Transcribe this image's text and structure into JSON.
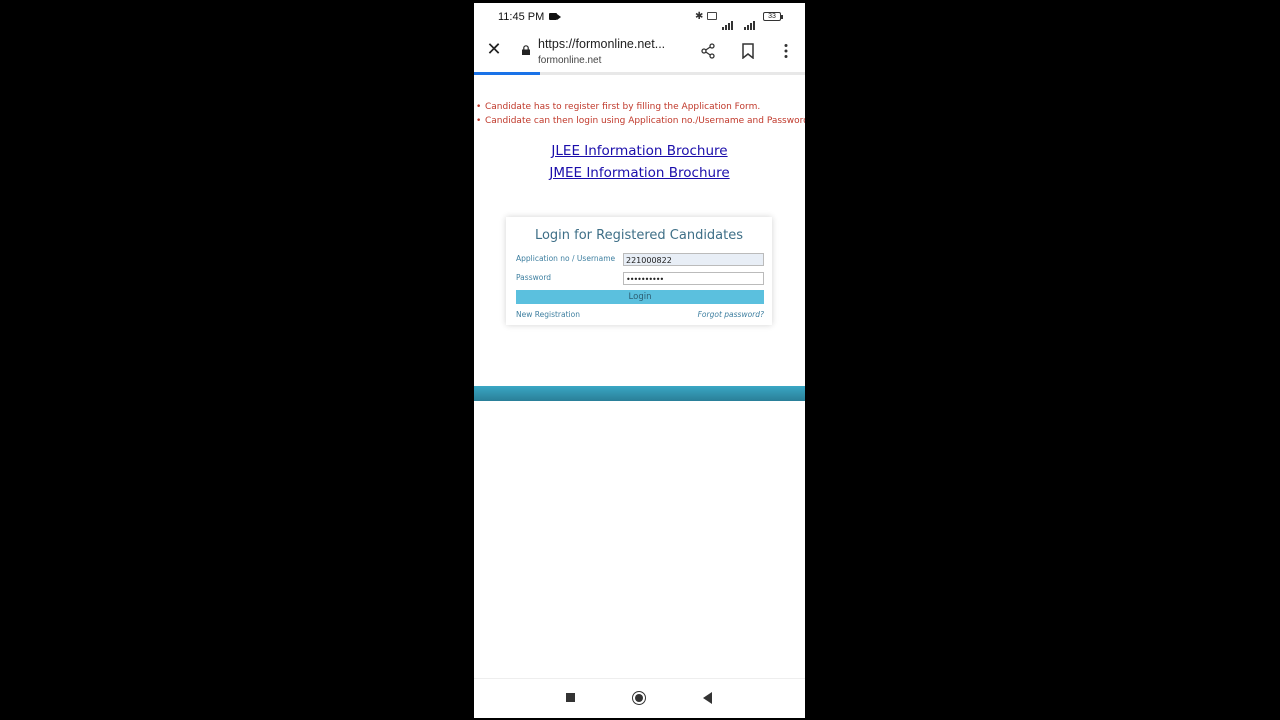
{
  "status_bar": {
    "time": "11:45 PM",
    "battery": "33",
    "icons": [
      "video-camera-icon",
      "bluetooth-icon",
      "nfc-icon",
      "signal-icon",
      "signal-icon",
      "battery-icon"
    ]
  },
  "browser": {
    "url": "https://formonline.net...",
    "domain": "formonline.net",
    "page_load_progress": 0.2,
    "icons": [
      "close-icon",
      "lock-icon",
      "share-icon",
      "bookmark-icon",
      "more-vert-icon"
    ]
  },
  "notes": [
    "Candidate has to register first by filling the Application Form.",
    "Candidate can then login using Application no./Username and Password"
  ],
  "links": {
    "jlee_brochure": "JLEE Information Brochure",
    "jmee_brochure": "JMEE Information Brochure"
  },
  "login": {
    "title": "Login for Registered Candidates",
    "application_label": "Application no / Username",
    "application_value": "221000822",
    "password_label": "Password",
    "password_value": "••••••••••",
    "login_button": "Login",
    "new_registration": "New Registration",
    "forgot_password": "Forgot password?"
  },
  "colors": {
    "note_text": "#c0392b",
    "link": "#1a0dab",
    "login_button": "#5bc0de",
    "footer_band": "#2a8fab",
    "progress": "#1a73e8"
  },
  "nav_bar": {
    "icons": [
      "recents-icon",
      "home-icon",
      "back-icon"
    ]
  }
}
